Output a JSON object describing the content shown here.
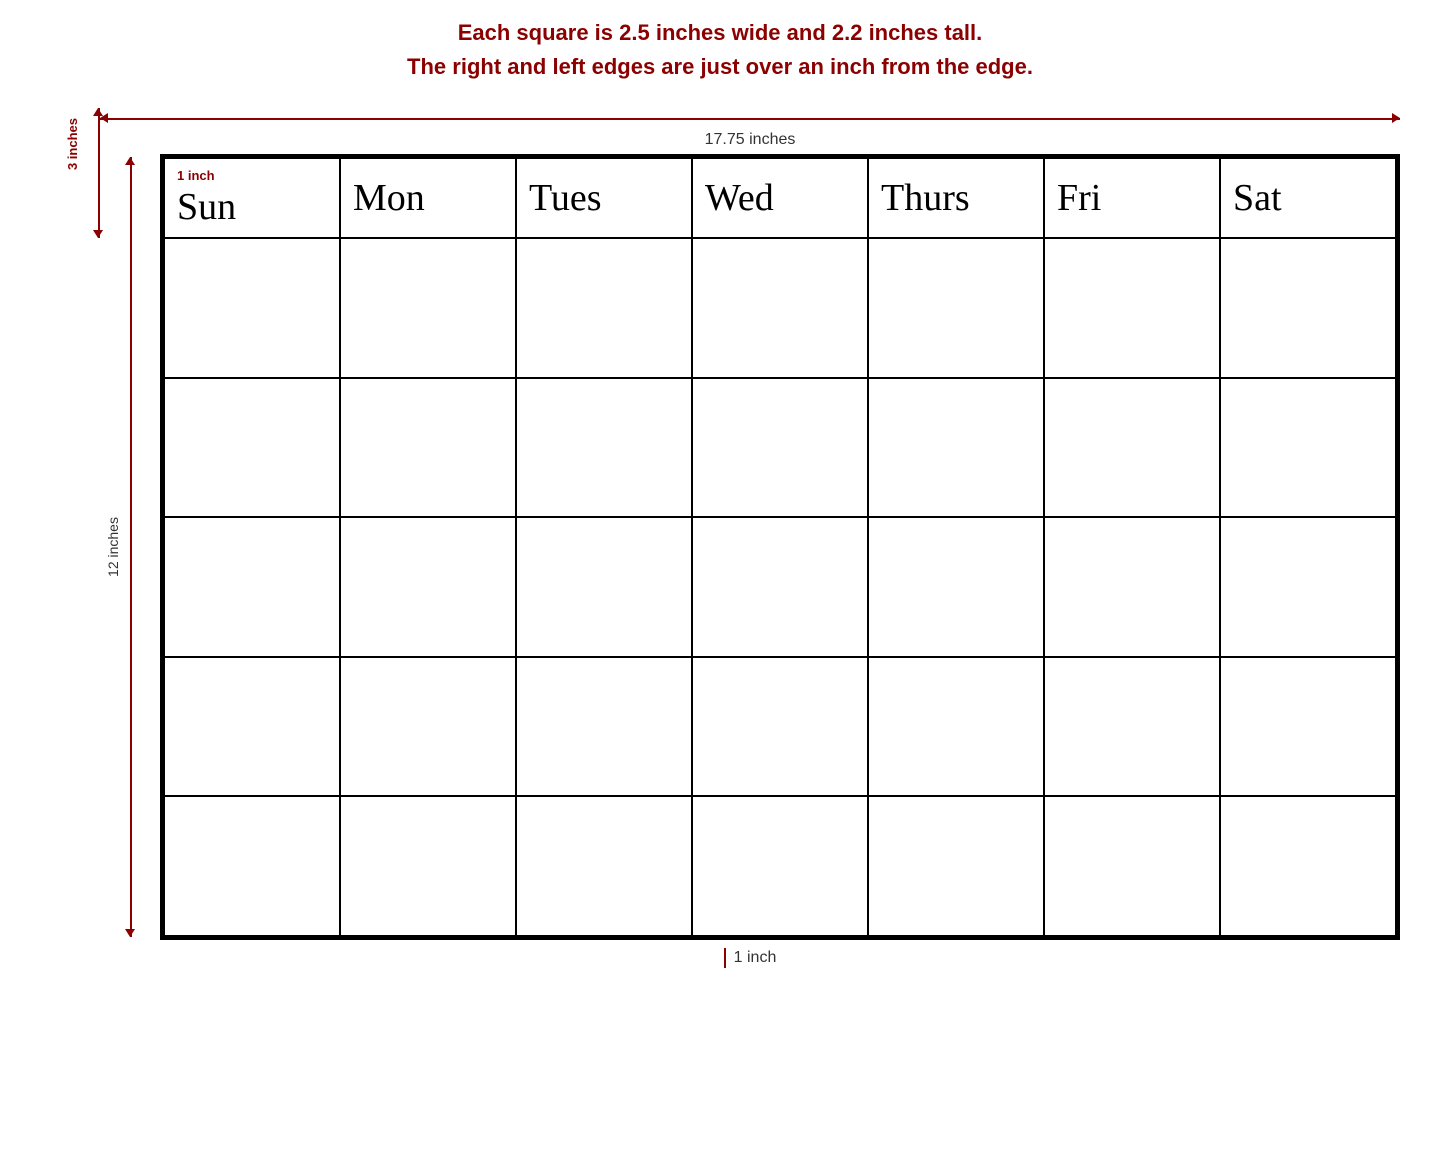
{
  "info": {
    "line1": "Each square is 2.5 inches wide and 2.2 inches tall.",
    "line2": "The right and left edges are just over an inch from the edge."
  },
  "measurements": {
    "top_3inch": "3 inches",
    "horizontal": "17.75 inches",
    "left_12inch": "12 inches",
    "bottom_1inch": "1 inch"
  },
  "calendar": {
    "days": [
      "Sun",
      "Mon",
      "Tues",
      "Wed",
      "Thurs",
      "Fri",
      "Sat"
    ],
    "rows": 5,
    "sun_label": "1 inch"
  }
}
